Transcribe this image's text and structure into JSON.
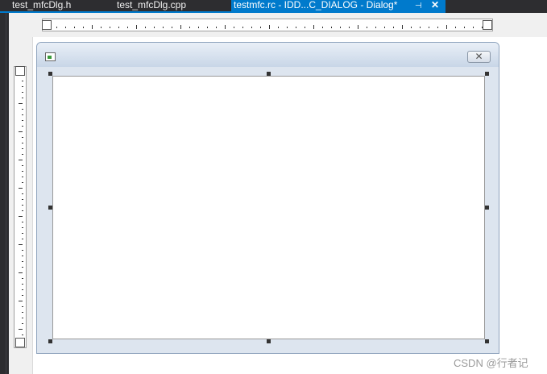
{
  "tabs": [
    {
      "label": "test_mfcDlg.h",
      "active": false
    },
    {
      "label": "test_mfcDlg.cpp",
      "active": false
    },
    {
      "label": "testmfc.rc - IDD...C_DIALOG - Dialog*",
      "active": true
    }
  ],
  "tab_icons": {
    "pin": "pin-icon",
    "close": "close-icon"
  },
  "dialog_window": {
    "close_icon": "close-icon",
    "app_icon": "dialog-app-icon"
  },
  "watermark": "CSDN @行者记",
  "colors": {
    "accent": "#007acc",
    "ide_background": "#2d2d30",
    "surface": "#f0f0f0"
  }
}
